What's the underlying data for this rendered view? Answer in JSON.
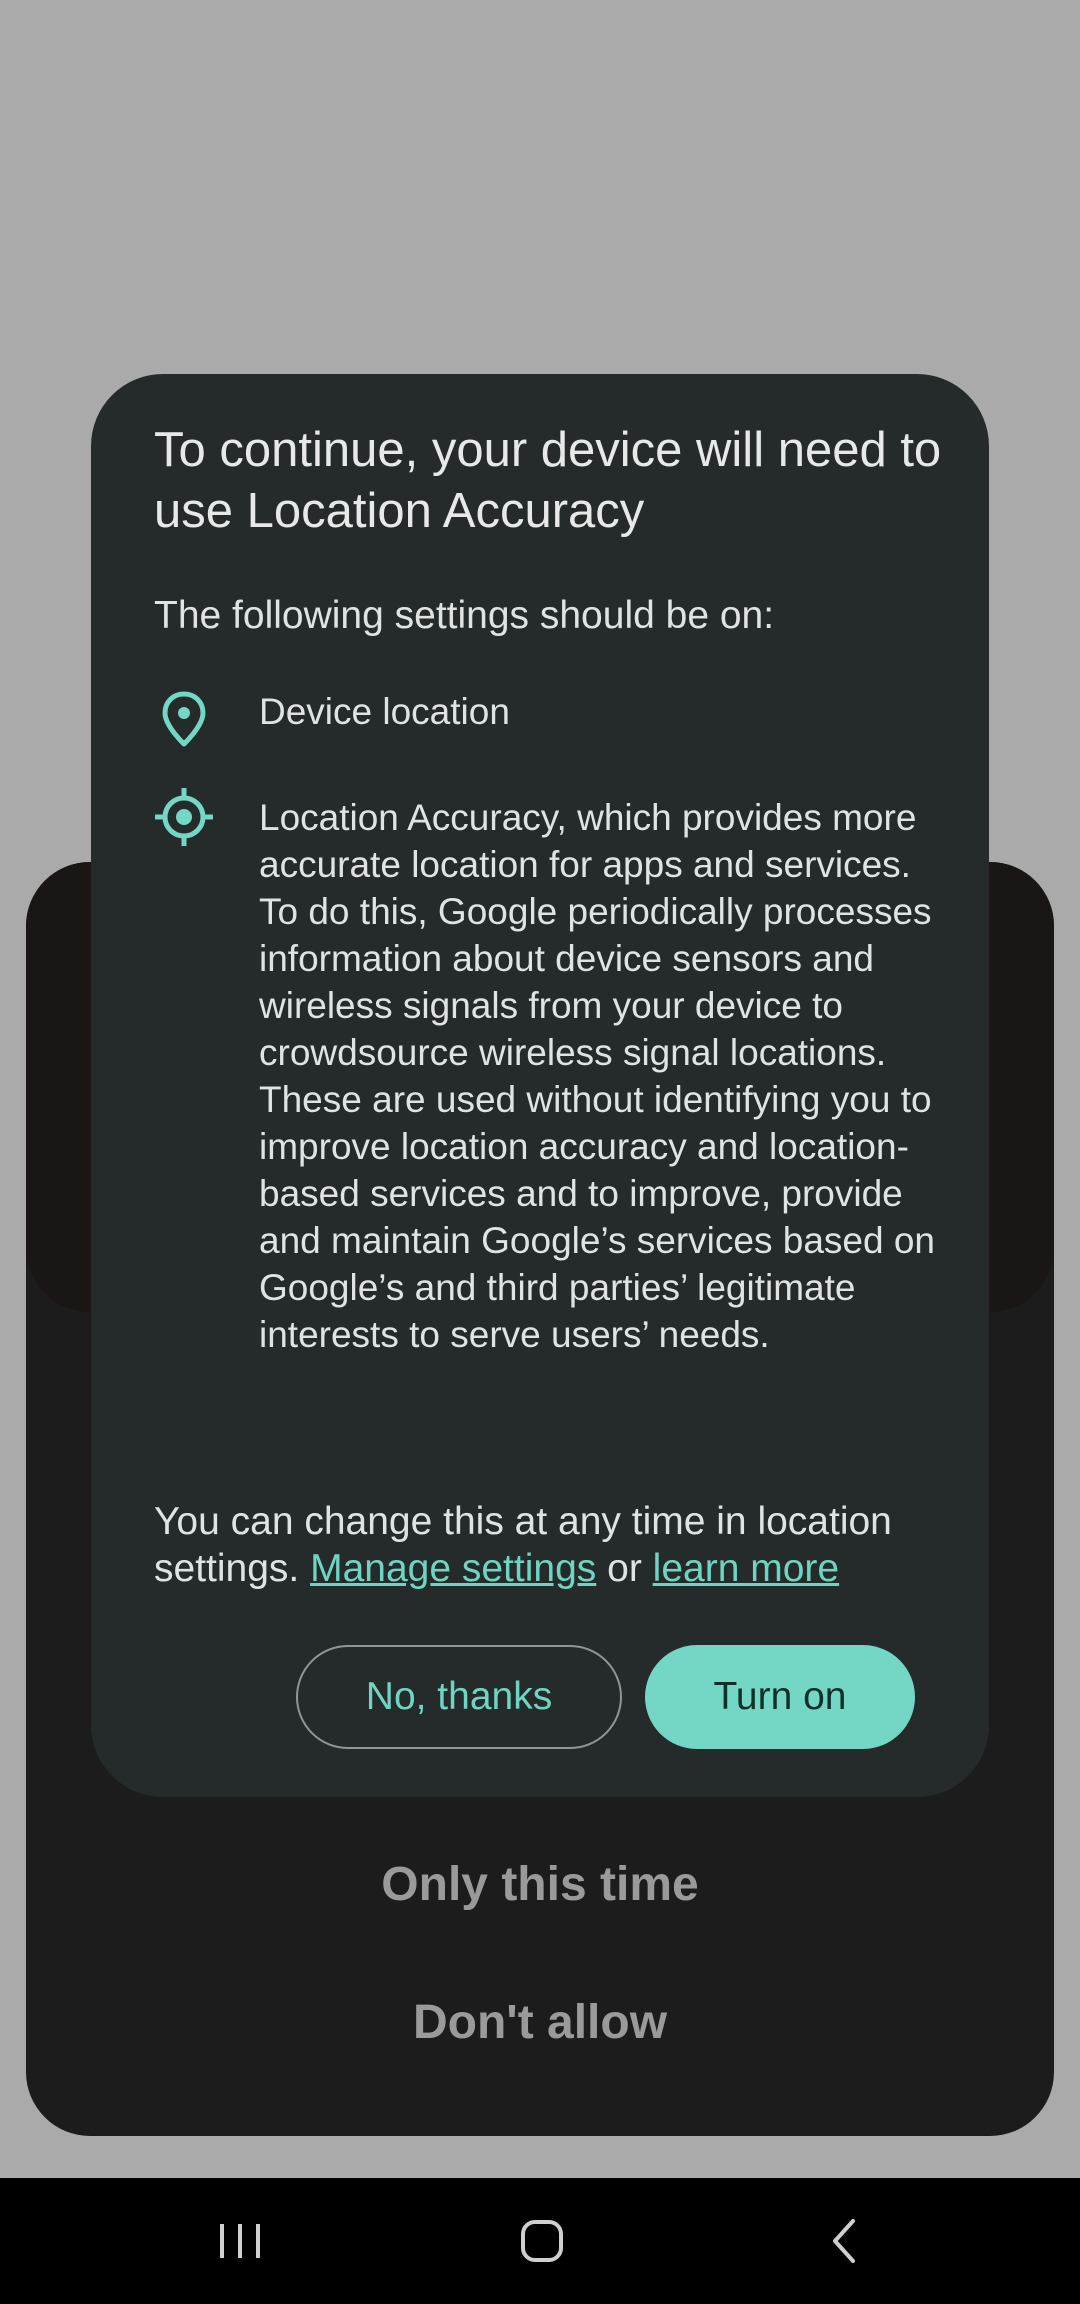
{
  "background_sheet": {
    "options": [
      "Only this time",
      "Don't allow"
    ]
  },
  "dialog": {
    "title": "To continue, your device will need to use Location Accuracy",
    "subtitle": "The following settings should be on:",
    "items": [
      {
        "icon": "location-pin-icon",
        "text": "Device location"
      },
      {
        "icon": "gps-target-icon",
        "text": "Location Accuracy, which provides more accurate location for apps and services. To do this, Google periodically processes information about device sensors and wireless signals from your device to crowdsource wireless signal locations. These are used without identifying you to improve location accuracy and location-based services and to improve, provide and maintain Google’s services based on Google’s and third parties’ legitimate interests to serve users’ needs."
      }
    ],
    "footer": {
      "prefix": "You can change this at any time in location settings.",
      "manage_link": "Manage settings",
      "or": "or",
      "learn_link": "learn more"
    },
    "buttons": {
      "no_thanks": "No, thanks",
      "turn_on": "Turn on"
    }
  },
  "navbar": {
    "icons": [
      "recent-apps-icon",
      "home-icon",
      "back-icon"
    ]
  },
  "colors": {
    "accent": "#74d6c4",
    "dialog_bg": "#252b2b",
    "scrim": "#aaaaaa"
  }
}
